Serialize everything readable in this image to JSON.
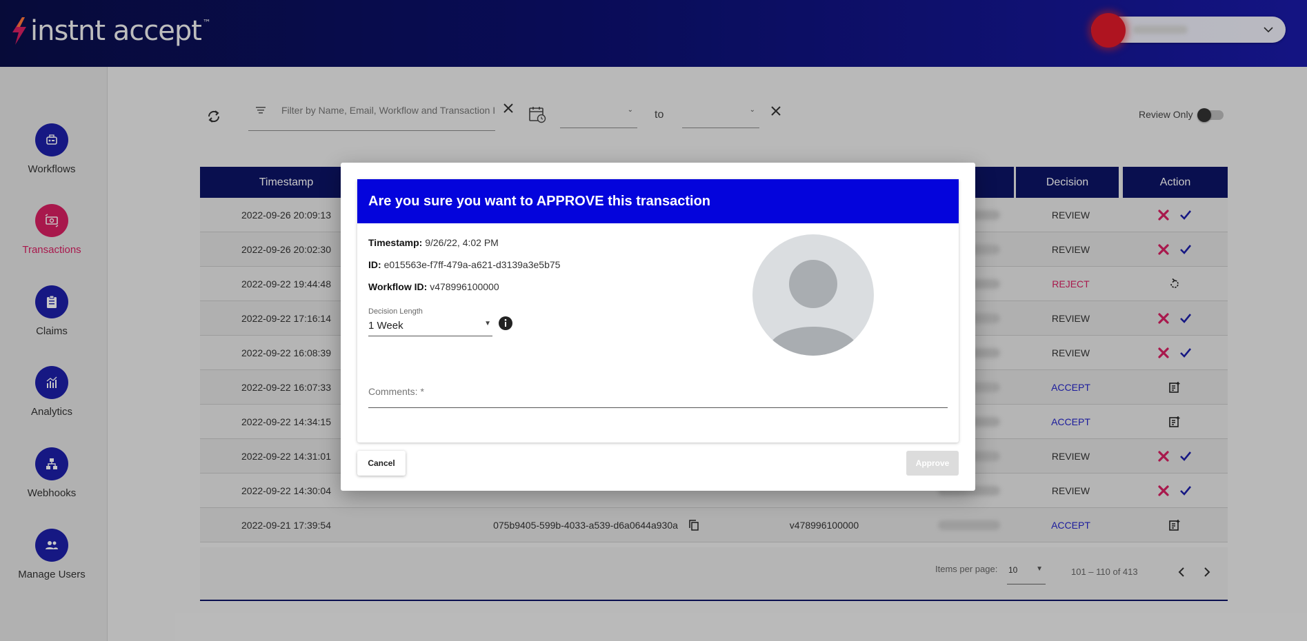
{
  "app": {
    "logo_text": "instnt accept",
    "logo_tm": "™"
  },
  "sidebar": {
    "items": [
      {
        "label": "Workflows",
        "icon": "workflows-icon",
        "active": false
      },
      {
        "label": "Transactions",
        "icon": "transactions-icon",
        "active": true
      },
      {
        "label": "Claims",
        "icon": "claims-icon",
        "active": false
      },
      {
        "label": "Analytics",
        "icon": "analytics-icon",
        "active": false
      },
      {
        "label": "Webhooks",
        "icon": "webhooks-icon",
        "active": false
      },
      {
        "label": "Manage Users",
        "icon": "manage-users-icon",
        "active": false
      }
    ]
  },
  "filters": {
    "search_placeholder": "Filter by Name, Email, Workflow and Transaction ID",
    "to_label": "to",
    "review_only_label": "Review Only",
    "review_only": false
  },
  "table": {
    "headers": {
      "timestamp": "Timestamp",
      "decision": "Decision",
      "action": "Action"
    },
    "rows": [
      {
        "timestamp": "2022-09-26 20:09:13",
        "id": "",
        "workflow": "",
        "decision": "REVIEW",
        "actions": [
          "reject",
          "approve"
        ]
      },
      {
        "timestamp": "2022-09-26 20:02:30",
        "id": "",
        "workflow": "",
        "decision": "REVIEW",
        "actions": [
          "reject",
          "approve"
        ]
      },
      {
        "timestamp": "2022-09-22 19:44:48",
        "id": "",
        "workflow": "",
        "decision": "REJECT",
        "actions": [
          "undo"
        ]
      },
      {
        "timestamp": "2022-09-22 17:16:14",
        "id": "",
        "workflow": "",
        "decision": "REVIEW",
        "actions": [
          "reject",
          "approve"
        ]
      },
      {
        "timestamp": "2022-09-22 16:08:39",
        "id": "",
        "workflow": "",
        "decision": "REVIEW",
        "actions": [
          "reject",
          "approve"
        ]
      },
      {
        "timestamp": "2022-09-22 16:07:33",
        "id": "",
        "workflow": "",
        "decision": "ACCEPT",
        "actions": [
          "note"
        ]
      },
      {
        "timestamp": "2022-09-22 14:34:15",
        "id": "",
        "workflow": "",
        "decision": "ACCEPT",
        "actions": [
          "note"
        ]
      },
      {
        "timestamp": "2022-09-22 14:31:01",
        "id": "",
        "workflow": "",
        "decision": "REVIEW",
        "actions": [
          "reject",
          "approve"
        ]
      },
      {
        "timestamp": "2022-09-22 14:30:04",
        "id": "",
        "workflow": "",
        "decision": "REVIEW",
        "actions": [
          "reject",
          "approve"
        ]
      },
      {
        "timestamp": "2022-09-21 17:39:54",
        "id": "075b9405-599b-4033-a539-d6a0644a930a",
        "workflow": "v478996100000",
        "decision": "ACCEPT",
        "actions": [
          "note"
        ]
      }
    ]
  },
  "paginator": {
    "items_per_page_label": "Items per page:",
    "items_per_page": "10",
    "range": "101 – 110 of 413"
  },
  "modal": {
    "title": "Are you sure you want to APPROVE this transaction",
    "timestamp_label": "Timestamp:",
    "timestamp_value": "9/26/22, 4:02 PM",
    "id_label": "ID:",
    "id_value": "e015563e-f7ff-479a-a621-d3139a3e5b75",
    "workflow_label": "Workflow ID:",
    "workflow_value": "v478996100000",
    "decision_length_label": "Decision Length",
    "decision_length_value": "1 Week",
    "comments_placeholder": "Comments: *",
    "cancel_label": "Cancel",
    "approve_label": "Approve"
  },
  "colors": {
    "primary": "#1d1fa8",
    "accent": "#d81f62",
    "header_dark": "#0c1466",
    "modal_title": "#0404dc",
    "accept": "#2424c8",
    "reject": "#d81f62"
  }
}
